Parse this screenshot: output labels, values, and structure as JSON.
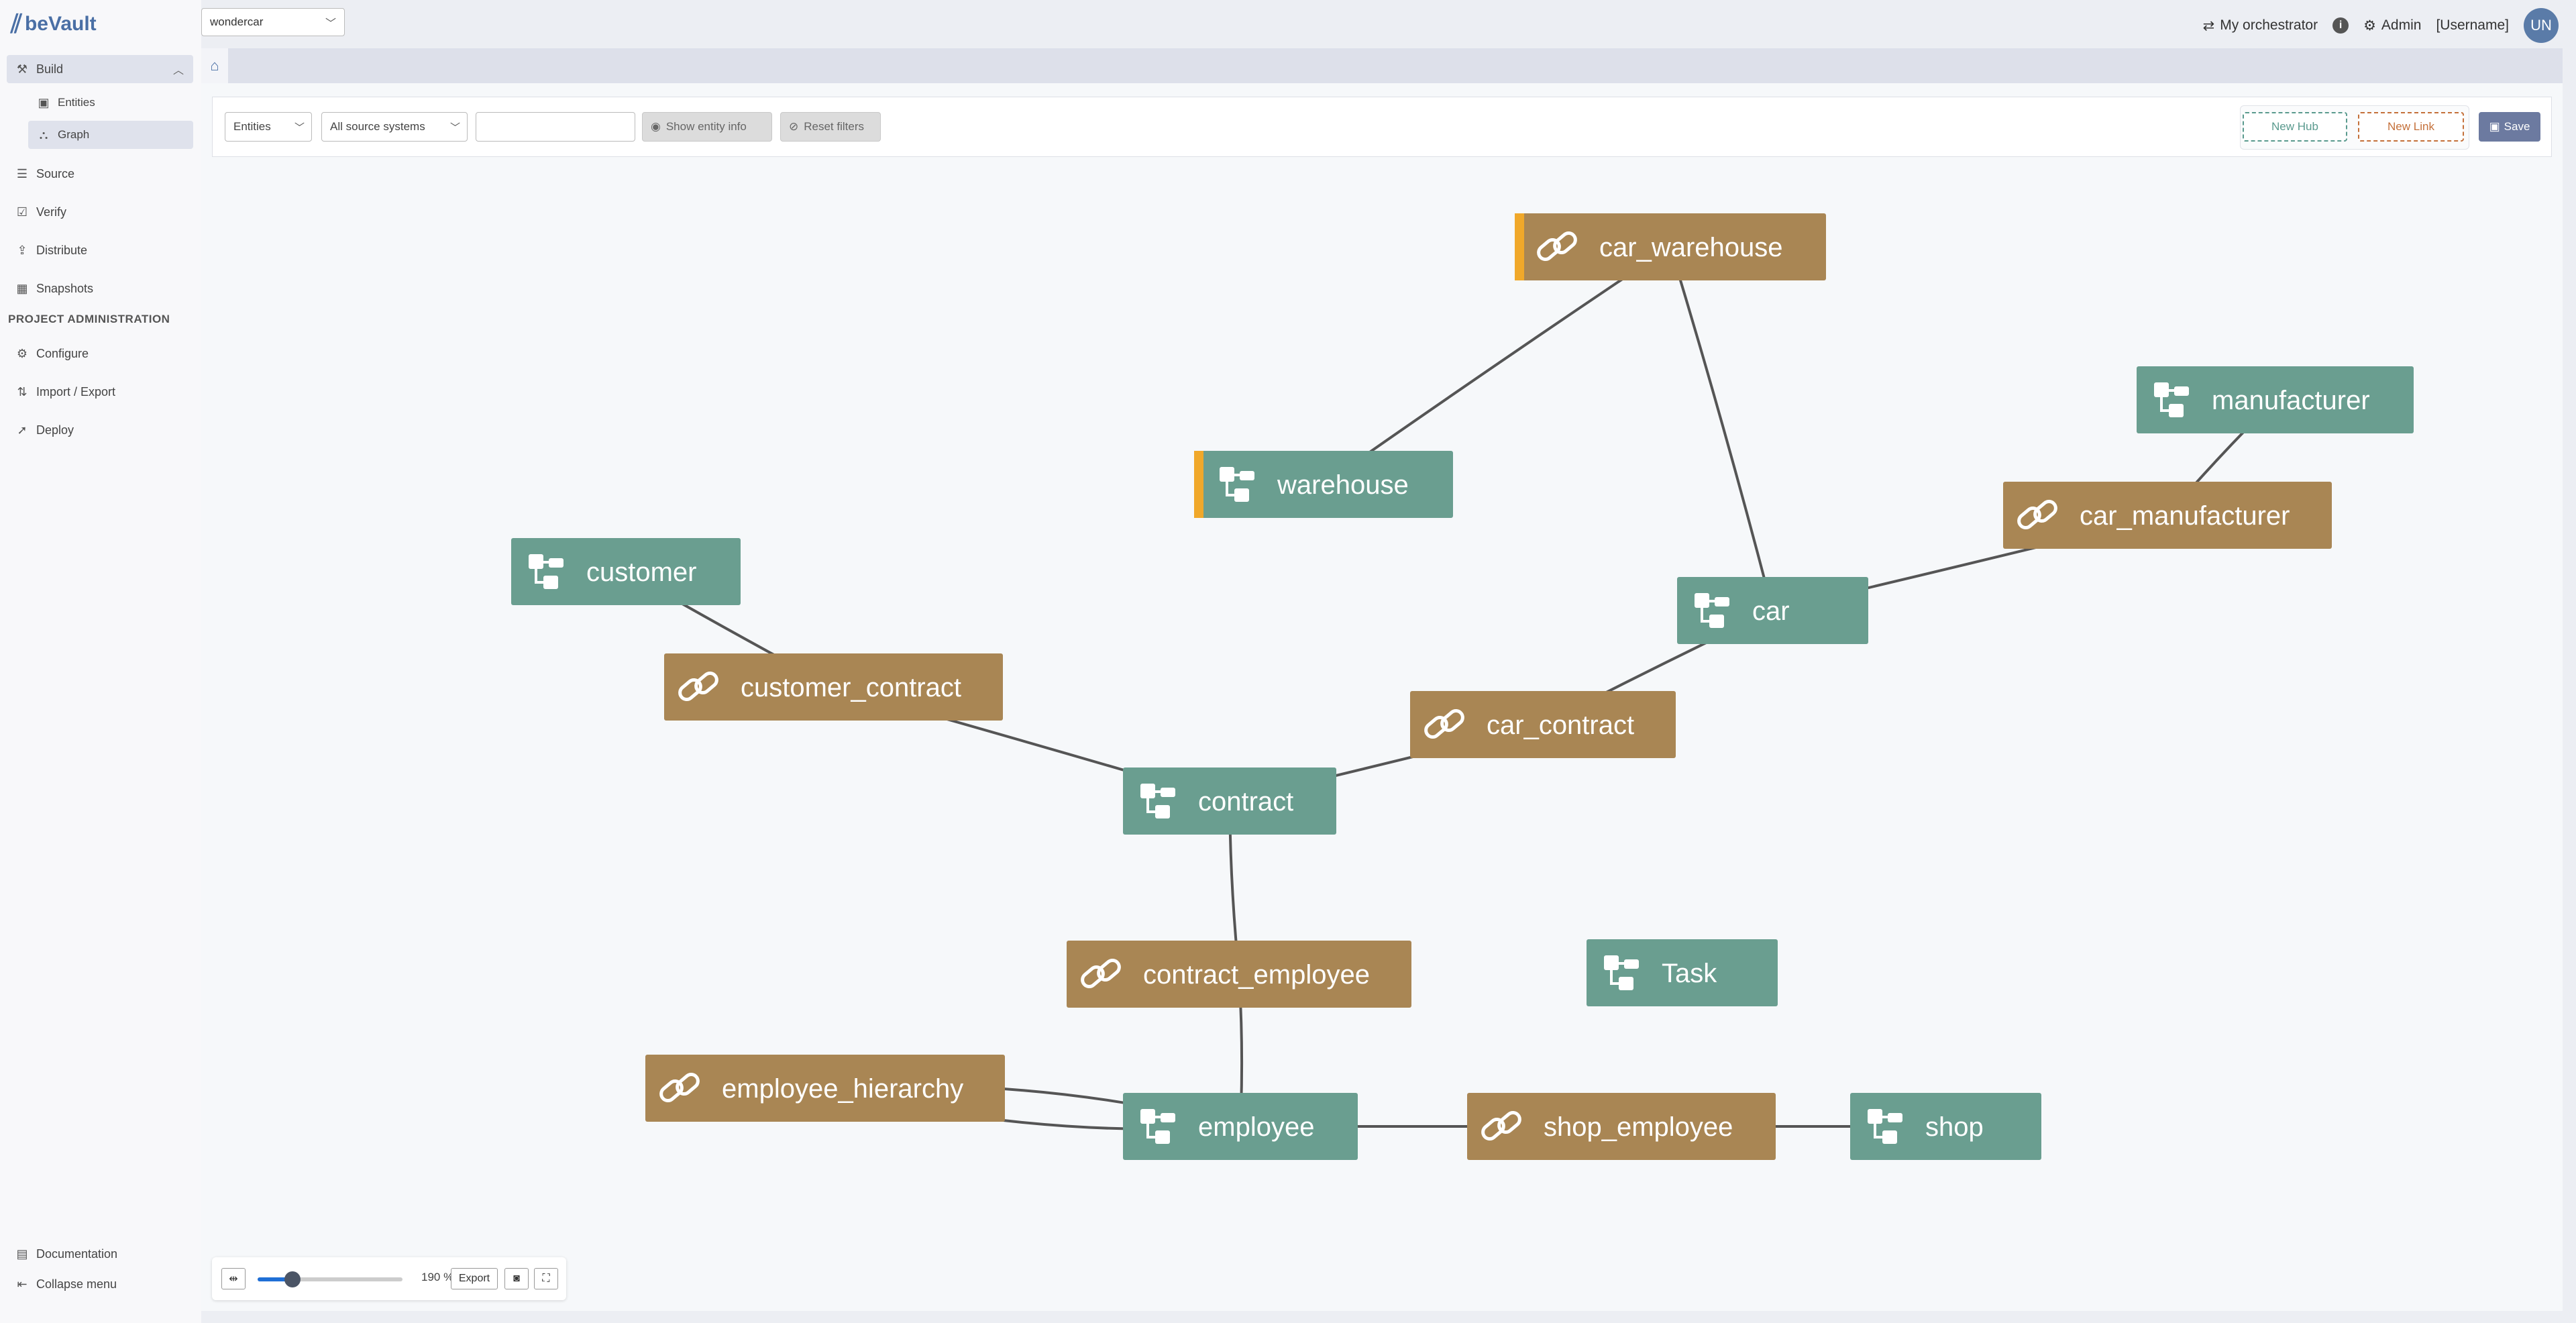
{
  "app": {
    "logo_text": "beVault",
    "project": "wondercar"
  },
  "sidebar": {
    "build": {
      "label": "Build",
      "icon": "hammer-icon"
    },
    "build_items": [
      {
        "label": "Entities",
        "icon": "cube-icon"
      },
      {
        "label": "Graph",
        "icon": "graph-icon",
        "active": true
      }
    ],
    "items": [
      {
        "label": "Source",
        "icon": "database-icon"
      },
      {
        "label": "Verify",
        "icon": "check-square-icon"
      },
      {
        "label": "Distribute",
        "icon": "share-icon"
      },
      {
        "label": "Snapshots",
        "icon": "calendar-icon"
      }
    ],
    "admin_header": "PROJECT ADMINISTRATION",
    "admin_items": [
      {
        "label": "Configure",
        "icon": "gear-icon"
      },
      {
        "label": "Import / Export",
        "icon": "import-export-icon"
      },
      {
        "label": "Deploy",
        "icon": "rocket-icon"
      }
    ],
    "footer": [
      {
        "label": "Documentation",
        "icon": "book-icon"
      },
      {
        "label": "Collapse menu",
        "icon": "collapse-icon"
      }
    ]
  },
  "topbar": {
    "orchestrator": "My orchestrator",
    "admin": "Admin",
    "username": "[Username]",
    "avatar_initials": "UN"
  },
  "toolbar": {
    "entities_select": "Entities",
    "source_select": "All source systems",
    "search_value": "",
    "show_entity_info": "Show entity info",
    "reset_filters": "Reset filters",
    "new_hub": "New Hub",
    "new_link": "New Link",
    "save": "Save"
  },
  "graph": {
    "colors": {
      "hub": "#6a9e90",
      "link": "#a98654",
      "edge": "#555555",
      "highlight": "#f0a82a"
    },
    "nodes": [
      {
        "id": "car_warehouse",
        "label": "car_warehouse",
        "type": "link",
        "highlight": true
      },
      {
        "id": "warehouse",
        "label": "warehouse",
        "type": "hub",
        "highlight": true
      },
      {
        "id": "manufacturer",
        "label": "manufacturer",
        "type": "hub"
      },
      {
        "id": "car_manufacturer",
        "label": "car_manufacturer",
        "type": "link"
      },
      {
        "id": "customer",
        "label": "customer",
        "type": "hub"
      },
      {
        "id": "car",
        "label": "car",
        "type": "hub"
      },
      {
        "id": "customer_contract",
        "label": "customer_contract",
        "type": "link"
      },
      {
        "id": "car_contract",
        "label": "car_contract",
        "type": "link"
      },
      {
        "id": "contract",
        "label": "contract",
        "type": "hub"
      },
      {
        "id": "contract_employee",
        "label": "contract_employee",
        "type": "link"
      },
      {
        "id": "Task",
        "label": "Task",
        "type": "hub"
      },
      {
        "id": "employee_hierarchy",
        "label": "employee_hierarchy",
        "type": "link"
      },
      {
        "id": "employee",
        "label": "employee",
        "type": "hub"
      },
      {
        "id": "shop_employee",
        "label": "shop_employee",
        "type": "link"
      },
      {
        "id": "shop",
        "label": "shop",
        "type": "hub"
      }
    ],
    "edges": [
      [
        "car_warehouse",
        "warehouse"
      ],
      [
        "car_warehouse",
        "car"
      ],
      [
        "manufacturer",
        "car_manufacturer"
      ],
      [
        "car_manufacturer",
        "car"
      ],
      [
        "customer",
        "customer_contract"
      ],
      [
        "customer_contract",
        "contract"
      ],
      [
        "car",
        "car_contract"
      ],
      [
        "car_contract",
        "contract"
      ],
      [
        "contract",
        "contract_employee"
      ],
      [
        "contract_employee",
        "employee"
      ],
      [
        "employee_hierarchy",
        "employee"
      ],
      [
        "employee_hierarchy",
        "employee"
      ],
      [
        "employee",
        "shop_employee"
      ],
      [
        "shop_employee",
        "shop"
      ]
    ]
  },
  "zoom": {
    "value": "190",
    "unit": "%",
    "fraction": 0.24,
    "export_label": "Export"
  }
}
